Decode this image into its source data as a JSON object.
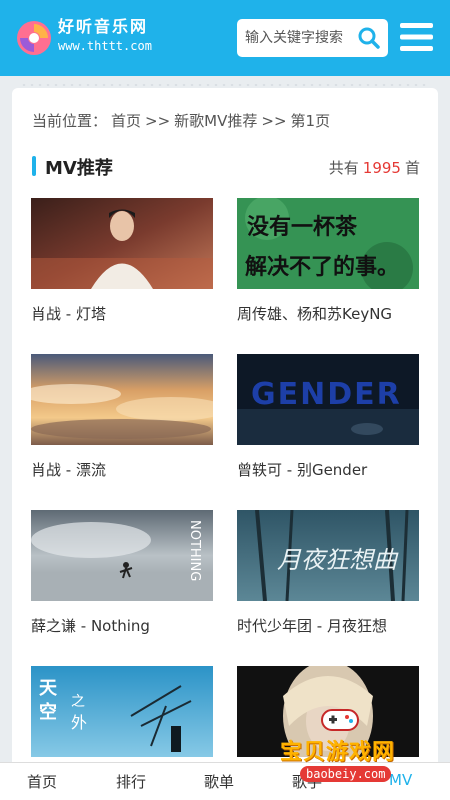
{
  "header": {
    "site_name": "好听音乐网",
    "site_url": "www.thttt.com",
    "search_placeholder": "输入关键字搜索"
  },
  "breadcrumb": {
    "prefix": "当前位置：",
    "items": [
      "首页",
      ">>",
      "新歌MV推荐",
      ">>",
      "第1页"
    ]
  },
  "section": {
    "title": "MV推荐",
    "total_prefix": "共有",
    "total_count": "1995",
    "total_suffix": "首"
  },
  "mvs": [
    {
      "title": "肖战 - 灯塔"
    },
    {
      "title": "周传雄、杨和苏KeyNG",
      "thumb_text": [
        "没有一杯茶",
        "解决不了的事。"
      ]
    },
    {
      "title": "肖战 - 漂流"
    },
    {
      "title": "曾轶可 - 别Gender",
      "thumb_text": [
        "GENDER"
      ]
    },
    {
      "title": "薛之谦 - Nothing",
      "thumb_text": [
        "NOTHING"
      ]
    },
    {
      "title": "时代少年团 - 月夜狂想",
      "thumb_text": [
        "月夜狂想曲"
      ]
    },
    {
      "title": "",
      "thumb_text": [
        "天",
        "空",
        "之",
        "外"
      ]
    },
    {
      "title": ""
    }
  ],
  "nav": {
    "items": [
      "首页",
      "排行",
      "歌单",
      "歌手",
      "MV"
    ],
    "active": "MV"
  },
  "watermark": {
    "text": "宝贝游戏网",
    "url": "baobeiy.com"
  },
  "colors": {
    "brand": "#1fb2ea",
    "count_red": "#e53935"
  }
}
